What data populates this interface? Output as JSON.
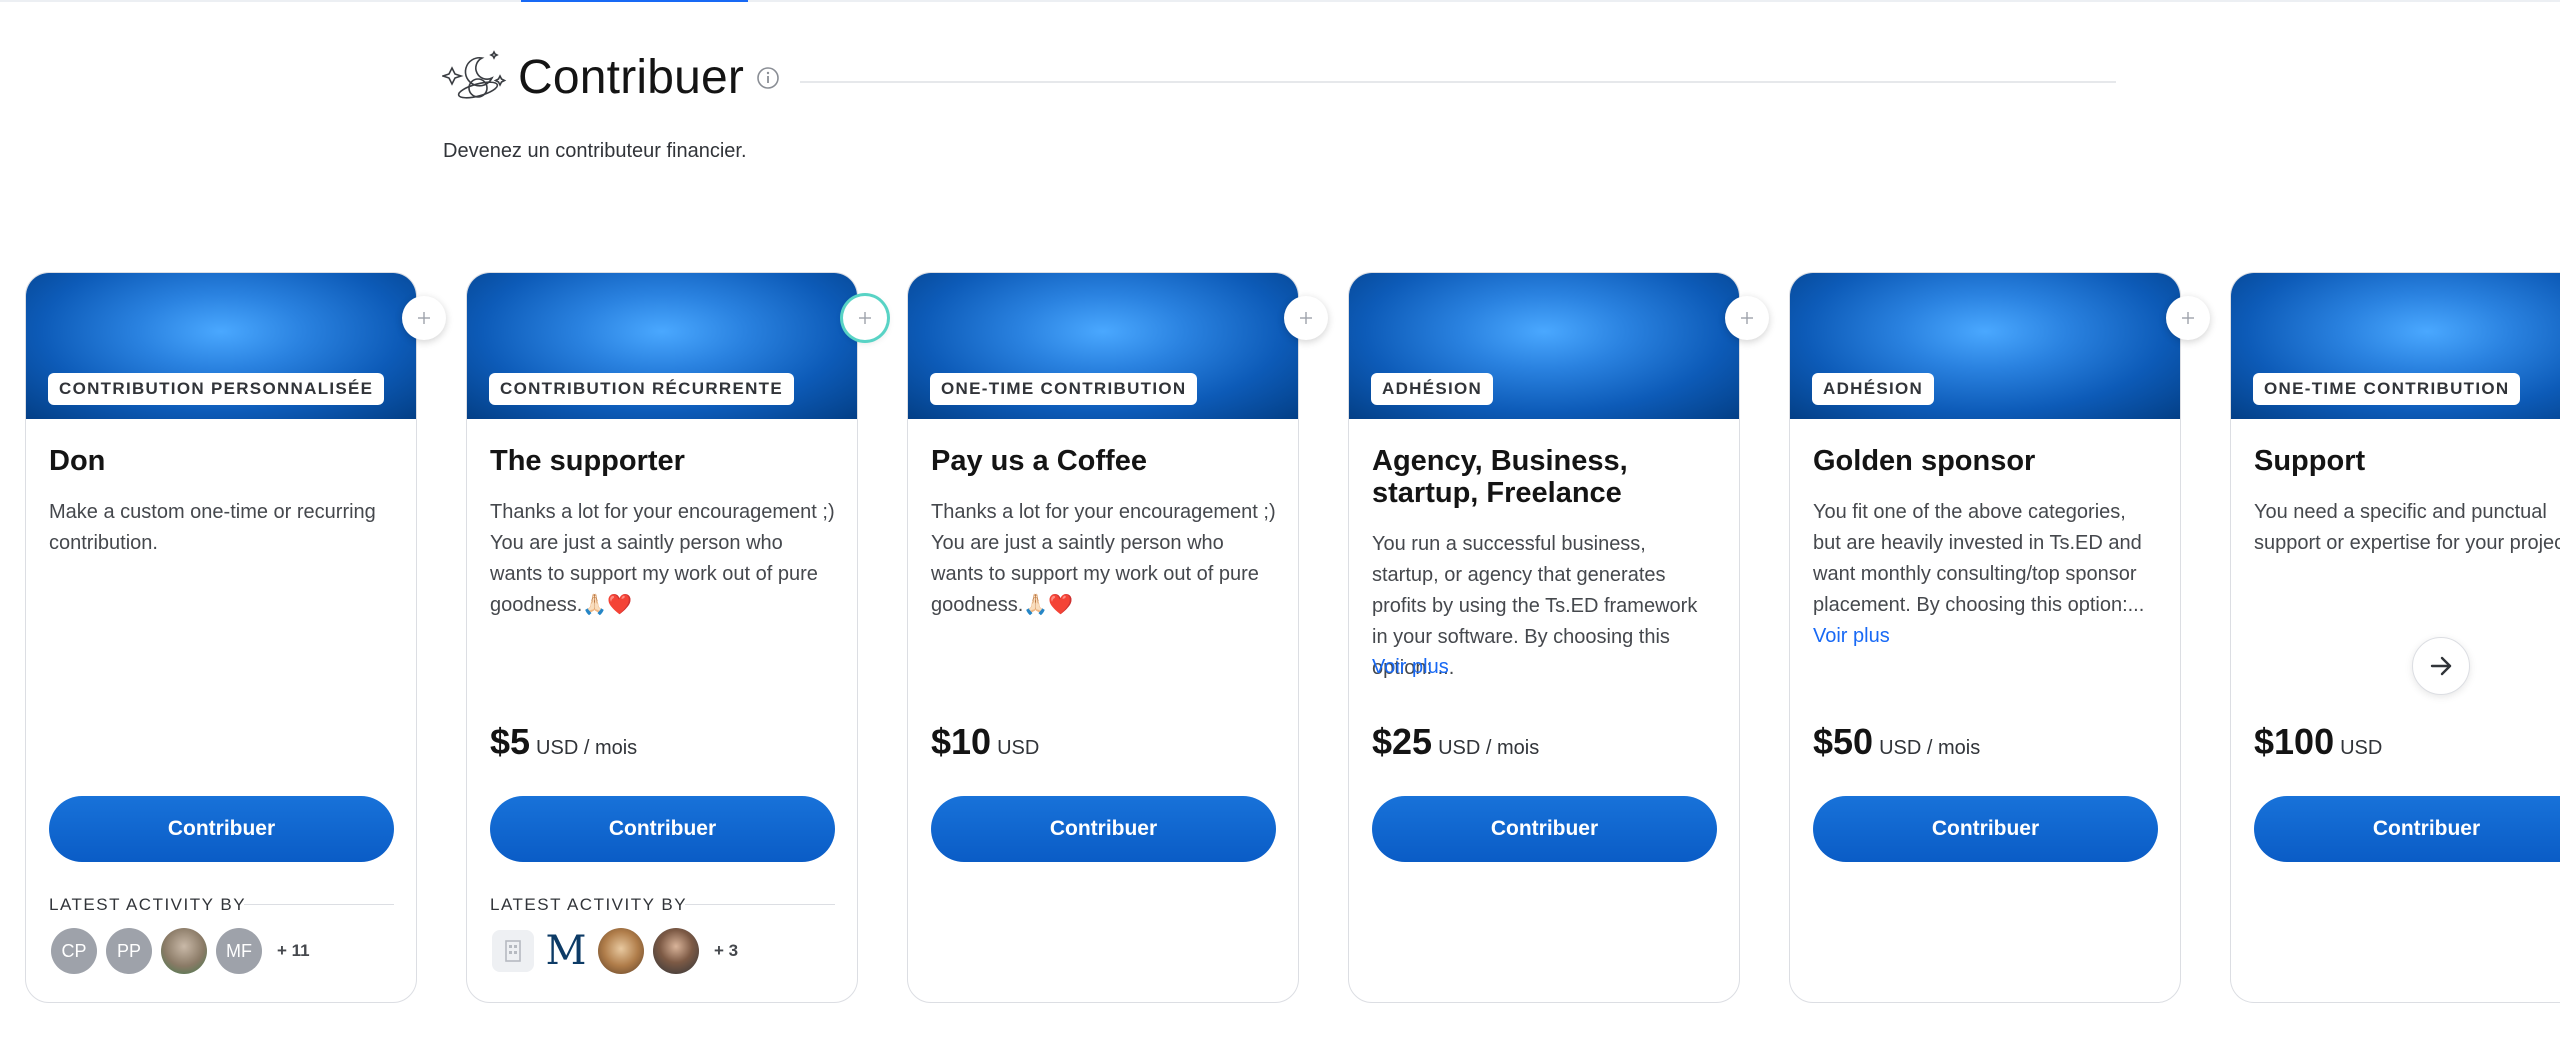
{
  "section": {
    "title": "Contribuer",
    "subtitle": "Devenez un contributeur financier."
  },
  "activity_label": "LATEST ACTIVITY BY",
  "cards": [
    {
      "type": "CONTRIBUTION PERSONNALISÉE",
      "title": "Don",
      "description": "Make a custom one-time or recurring contribution.",
      "read_more": "",
      "price": "",
      "price_unit": "",
      "button": "Contribuer",
      "avatars": [
        "CP",
        "PP",
        "",
        "MF"
      ],
      "more": "+ 11"
    },
    {
      "type": "CONTRIBUTION RÉCURRENTE",
      "title": "The supporter",
      "description": "Thanks a lot for your encouragement ;) You are just a saintly person who wants to support my work out of pure goodness.🙏🏻❤️",
      "read_more": "",
      "price": "$5",
      "price_unit": "USD / mois",
      "button": "Contribuer",
      "avatars": [
        "",
        "M",
        "",
        ""
      ],
      "more": "+ 3"
    },
    {
      "type": "ONE-TIME CONTRIBUTION",
      "title": "Pay us a Coffee",
      "description": "Thanks a lot for your encouragement ;) You are just a saintly person who wants to support my work out of pure goodness.🙏🏻❤️",
      "read_more": "",
      "price": "$10",
      "price_unit": "USD",
      "button": "Contribuer"
    },
    {
      "type": "ADHÉSION",
      "title": "Agency, Business, startup, Freelance",
      "description": "You run a successful business, startup, or agency that generates profits by using the Ts.ED framework in your software. By choosing this option: ...",
      "read_more": "Voir plus",
      "price": "$25",
      "price_unit": "USD / mois",
      "button": "Contribuer"
    },
    {
      "type": "ADHÉSION",
      "title": "Golden sponsor",
      "description": "You fit one of the above categories, but are heavily invested in Ts.ED and want monthly consulting/top sponsor placement. By choosing this option:...",
      "read_more": "Voir plus",
      "price": "$50",
      "price_unit": "USD / mois",
      "button": "Contribuer"
    },
    {
      "type": "ONE-TIME CONTRIBUTION",
      "title": "Support",
      "description": "You need a specific and punctual support or expertise for your project",
      "read_more": "",
      "price": "$100",
      "price_unit": "USD",
      "button": "Contribuer"
    }
  ],
  "colors": {
    "accent": "#1869f5",
    "button": "#0a5cc6",
    "cover_dark": "#033f86",
    "cover_light": "#4aa8ff"
  },
  "icons": {
    "section": "space-planet-icon",
    "info": "info-icon",
    "share": "move-icon",
    "next": "arrow-right-icon"
  }
}
